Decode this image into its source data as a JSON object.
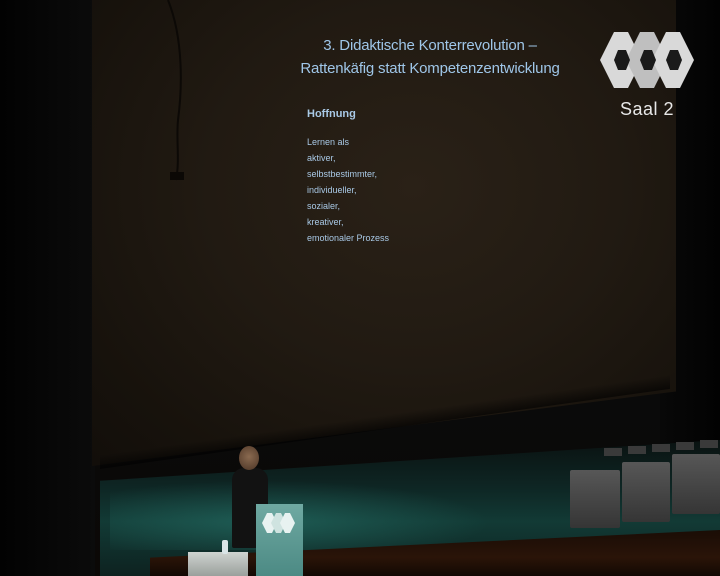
{
  "slide": {
    "title_line1": "3.  Didaktische Konterrevolution –",
    "title_line2": "Rattenkäfig statt Kompetenzentwicklung",
    "heading": "Hoffnung",
    "items": [
      "Lernen als",
      "aktiver,",
      "selbstbestimmter,",
      "individueller,",
      "sozialer,",
      "kreativer,",
      "emotionaler Prozess"
    ]
  },
  "overlay": {
    "room_label": "Saal 2",
    "logo_icon": "conference-logo-icon"
  },
  "colors": {
    "slide_text": "#a9c9e6",
    "screen_bg": "#221a12",
    "stage_teal": "#123a35",
    "lectern": "#5d9c95"
  }
}
